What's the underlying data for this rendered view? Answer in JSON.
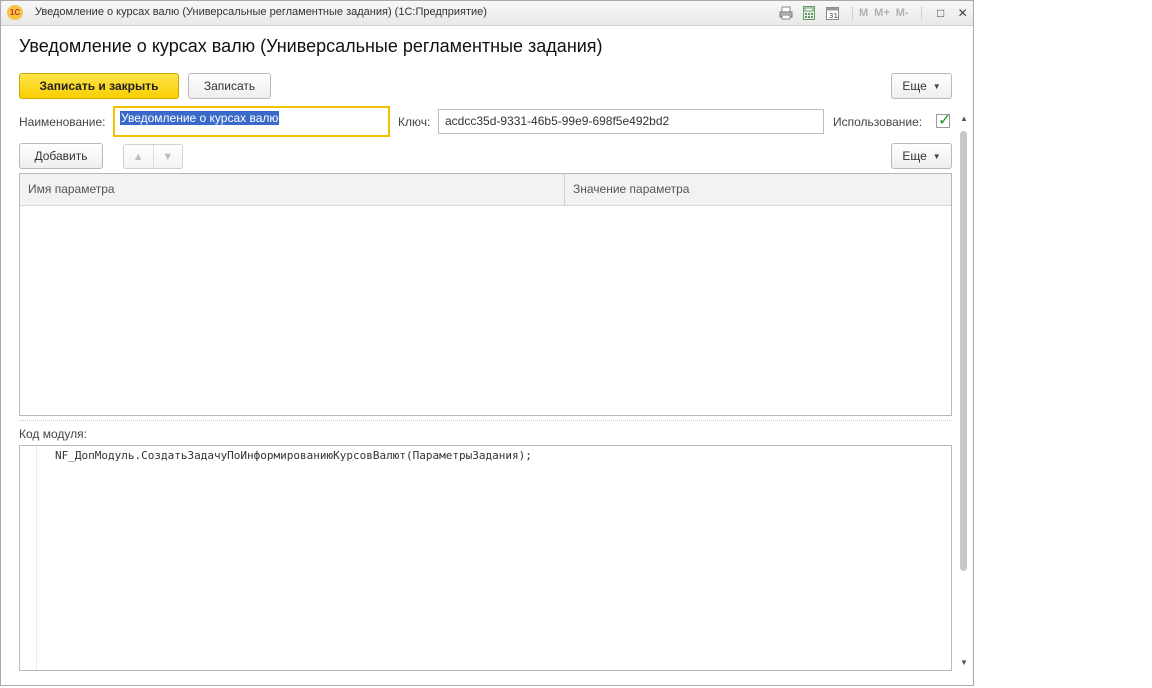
{
  "window": {
    "title": "Уведомление о курсах валю (Универсальные регламентные задания)  (1С:Предприятие)",
    "logo": "1С",
    "toolbar_icons": [
      "print-icon",
      "calculator-icon",
      "calendar-icon"
    ],
    "memory_buttons": [
      "M",
      "M+",
      "M-"
    ],
    "controls": {
      "maximize": "□",
      "close": "✕"
    }
  },
  "page_title": "Уведомление о курсах валю (Универсальные регламентные задания)",
  "command_bar": {
    "save_and_close": "Записать и закрыть",
    "save": "Записать",
    "more": "Еще"
  },
  "fields": {
    "name_label": "Наименование:",
    "name_value": "Уведомление о курсах валю",
    "key_label": "Ключ:",
    "key_value": "acdcc35d-9331-46b5-99e9-698f5e492bd2",
    "usage_label": "Использование:",
    "usage_checked": true
  },
  "params_bar": {
    "add": "Добавить",
    "more": "Еще"
  },
  "params_table": {
    "columns": [
      "Имя параметра",
      "Значение параметра"
    ],
    "rows": []
  },
  "module": {
    "label": "Код модуля:",
    "code": "NF_ДопМодуль.СоздатьЗадачуПоИнформированиюКурсовВалют(ПараметрыЗадания);"
  },
  "colors": {
    "primary_button": "#f9cf00",
    "selection": "#3a6ac9",
    "checkmark": "#1f9a2b"
  }
}
